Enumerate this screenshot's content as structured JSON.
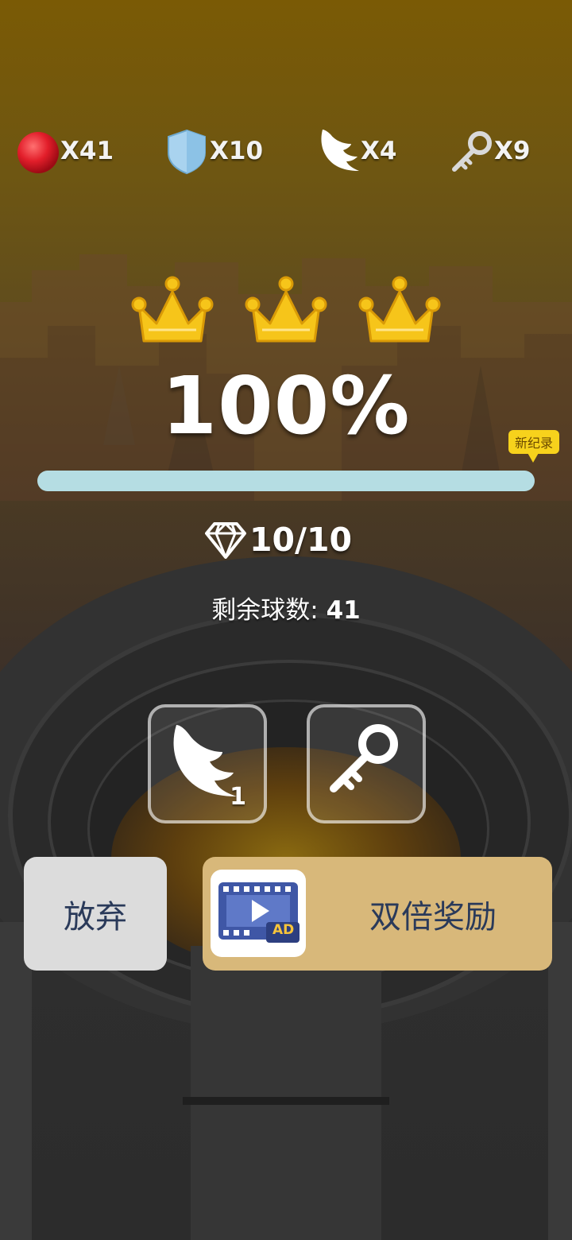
{
  "hud": {
    "balls": "X41",
    "shields": "X10",
    "wings": "X4",
    "keys": "X9"
  },
  "result": {
    "crowns_earned": 3,
    "crowns_total": 3,
    "percent_text": "100%",
    "progress_fraction": 1.0,
    "record_badge": "新纪录",
    "gems_text": "10/10",
    "balls_left_label": "剩余球数:",
    "balls_left_value": "41"
  },
  "items": {
    "wing": {
      "icon": "wing-icon",
      "count": "1"
    },
    "key": {
      "icon": "key-icon"
    }
  },
  "buttons": {
    "quit_label": "放弃",
    "double_label": "双倍奖励",
    "ad_icon": "video-ad-icon",
    "ad_badge": "AD"
  },
  "colors": {
    "crown": "#f6c51a",
    "progress_fill": "#b5dde3",
    "record_badge": "#f7d21c",
    "quit_bg": "#dcdcdc",
    "double_bg": "#d8b87a",
    "ad_blue": "#3f57a6"
  }
}
